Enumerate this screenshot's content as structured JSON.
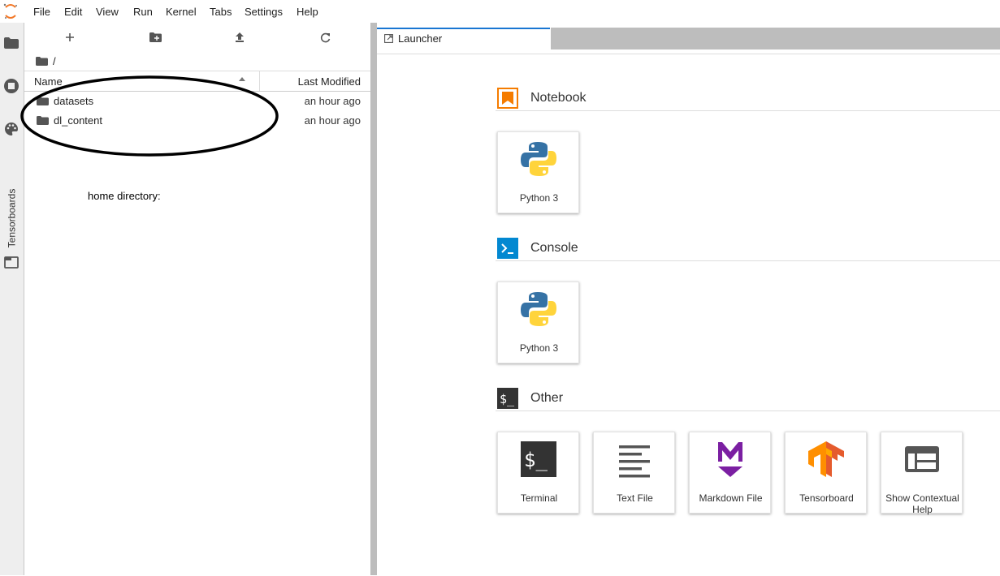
{
  "menubar": {
    "items": [
      "File",
      "Edit",
      "View",
      "Run",
      "Kernel",
      "Tabs",
      "Settings",
      "Help"
    ]
  },
  "sidebar": {
    "tensorboards_label": "Tensorboards"
  },
  "filebrowser": {
    "breadcrumb": "/",
    "columns": {
      "name": "Name",
      "modified": "Last Modified"
    },
    "rows": [
      {
        "name": "datasets",
        "modified": "an hour ago"
      },
      {
        "name": "dl_content",
        "modified": "an hour ago"
      }
    ],
    "annotation": "home directory:"
  },
  "tabs": {
    "launcher_label": "Launcher"
  },
  "launcher": {
    "sections": [
      {
        "title": "Notebook",
        "cards": [
          {
            "label": "Python 3",
            "icon": "python-icon"
          }
        ]
      },
      {
        "title": "Console",
        "cards": [
          {
            "label": "Python 3",
            "icon": "python-icon"
          }
        ]
      },
      {
        "title": "Other",
        "cards": [
          {
            "label": "Terminal",
            "icon": "terminal-icon"
          },
          {
            "label": "Text File",
            "icon": "text-file-icon"
          },
          {
            "label": "Markdown File",
            "icon": "markdown-icon"
          },
          {
            "label": "Tensorboard",
            "icon": "tensorflow-icon"
          },
          {
            "label": "Show Contextual Help",
            "icon": "contextual-help-icon"
          }
        ]
      }
    ]
  },
  "colors": {
    "accent": "#1976d2",
    "notebook_orange": "#f57c00",
    "console_blue": "#0288d1",
    "markdown_purple": "#7b1fa2",
    "tensorflow_orange": "#ff8f00"
  }
}
